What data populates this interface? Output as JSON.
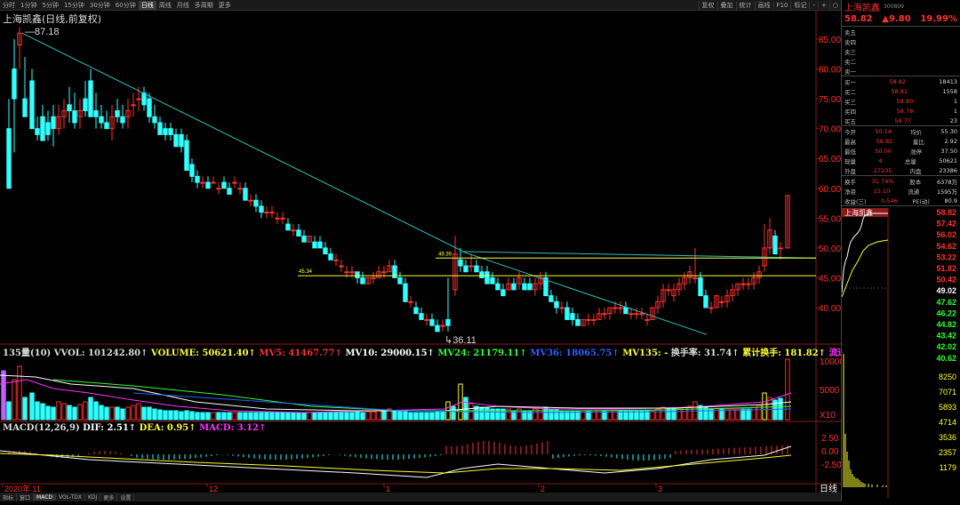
{
  "toolbar": {
    "periods": [
      "分时",
      "1分钟",
      "5分钟",
      "15分钟",
      "30分钟",
      "60分钟",
      "日线",
      "周线",
      "月线",
      "多周期",
      "更多"
    ],
    "active": "日线",
    "right_items": [
      "叠加",
      "统计",
      "画线",
      "F10",
      "标记",
      "-",
      "+",
      "○"
    ],
    "extra_right": "复权"
  },
  "chart": {
    "title": "上海凯鑫(日线,前复权)",
    "high_label": "87.18",
    "low_label": "36.11",
    "line1_label": "49.39",
    "line2_label": "45.34",
    "price_ticks": [
      "85.00",
      "80.00",
      "75.00",
      "70.00",
      "65.00",
      "60.00",
      "55.00",
      "50.00",
      "45.00",
      "40.00"
    ],
    "volume_ticks": [
      "10000",
      "5000",
      "X10"
    ],
    "macd_ticks": [
      "2.50",
      "0.00",
      "-2.50"
    ],
    "date_labels": [
      "2020年 11",
      "12",
      "1",
      "2",
      "3"
    ],
    "period_label": "日线"
  },
  "volume_header": {
    "label": "135量(10) VVOL: 101242.80↑",
    "volume": "VOLUME: 50621.40↑",
    "mv5": "MV5: 41467.77↑",
    "mv10": "MV10: 29000.15↑",
    "mv24": "MV24: 21179.11↑",
    "mv36": "MV36: 18065.75↑",
    "mv135": "MV135: -",
    "turnover": "换手率: 31.74↑",
    "cum_turnover": "累计换手: 181.82↑",
    "float": "流通盘"
  },
  "macd_header": {
    "label": "MACD(12,26,9)",
    "dif": "DIF: 2.51↑",
    "dea": "DEA: 0.95↑",
    "macd": "MACD: 3.12↑"
  },
  "bottom_tabs": [
    "指标",
    "窗口",
    "MACD",
    "VOL-TDX",
    "KDJ",
    "更多",
    "设置"
  ],
  "quote": {
    "name": "上海凯鑫",
    "code": "300899",
    "price": "58.82",
    "change": "▲9.80",
    "pct": "19.99%",
    "sell": [
      {
        "k": "卖五",
        "p": "",
        "v": ""
      },
      {
        "k": "卖四",
        "p": "",
        "v": ""
      },
      {
        "k": "卖三",
        "p": "",
        "v": ""
      },
      {
        "k": "卖二",
        "p": "",
        "v": ""
      },
      {
        "k": "卖一",
        "p": "",
        "v": ""
      }
    ],
    "buy": [
      {
        "k": "买一",
        "p": "58.82",
        "v": "18413"
      },
      {
        "k": "买二",
        "p": "58.81",
        "v": "1558"
      },
      {
        "k": "买三",
        "p": "58.80",
        "v": "1"
      },
      {
        "k": "买四",
        "p": "58.78",
        "v": "1"
      },
      {
        "k": "买五",
        "p": "58.77",
        "v": "23"
      }
    ],
    "stats": [
      {
        "k1": "今开",
        "v1": "50.14",
        "k2": "均价",
        "v2": "55.30"
      },
      {
        "k1": "最高",
        "v1": "58.82",
        "k2": "量比",
        "v2": "2.92"
      },
      {
        "k1": "最低",
        "v1": "50.00",
        "k2": "涨停",
        "v2": "37.50"
      },
      {
        "k1": "现量",
        "v1": "4",
        "k2": "总量",
        "v2": "50621"
      },
      {
        "k1": "外盘",
        "v1": "27235",
        "k2": "内盘",
        "v2": "23386"
      }
    ],
    "stats2": [
      {
        "k1": "换手",
        "v1": "31.74%",
        "k2": "股本",
        "v2": "6378万"
      },
      {
        "k1": "净资",
        "v1": "15.10",
        "k2": "流通",
        "v2": "1595万"
      },
      {
        "k1": "收益(三)",
        "v1": "0.546",
        "k2": "PE(动)",
        "v2": "80.9"
      }
    ],
    "mini_ticks": [
      "58.82",
      "57.42",
      "56.02",
      "54.62",
      "53.22",
      "51.82",
      "50.42",
      "49.02",
      "47.62",
      "46.22",
      "44.82",
      "43.42",
      "42.02",
      "40.62",
      "8250",
      "7071",
      "5893",
      "4714",
      "3536",
      "2357",
      "1179"
    ]
  }
}
